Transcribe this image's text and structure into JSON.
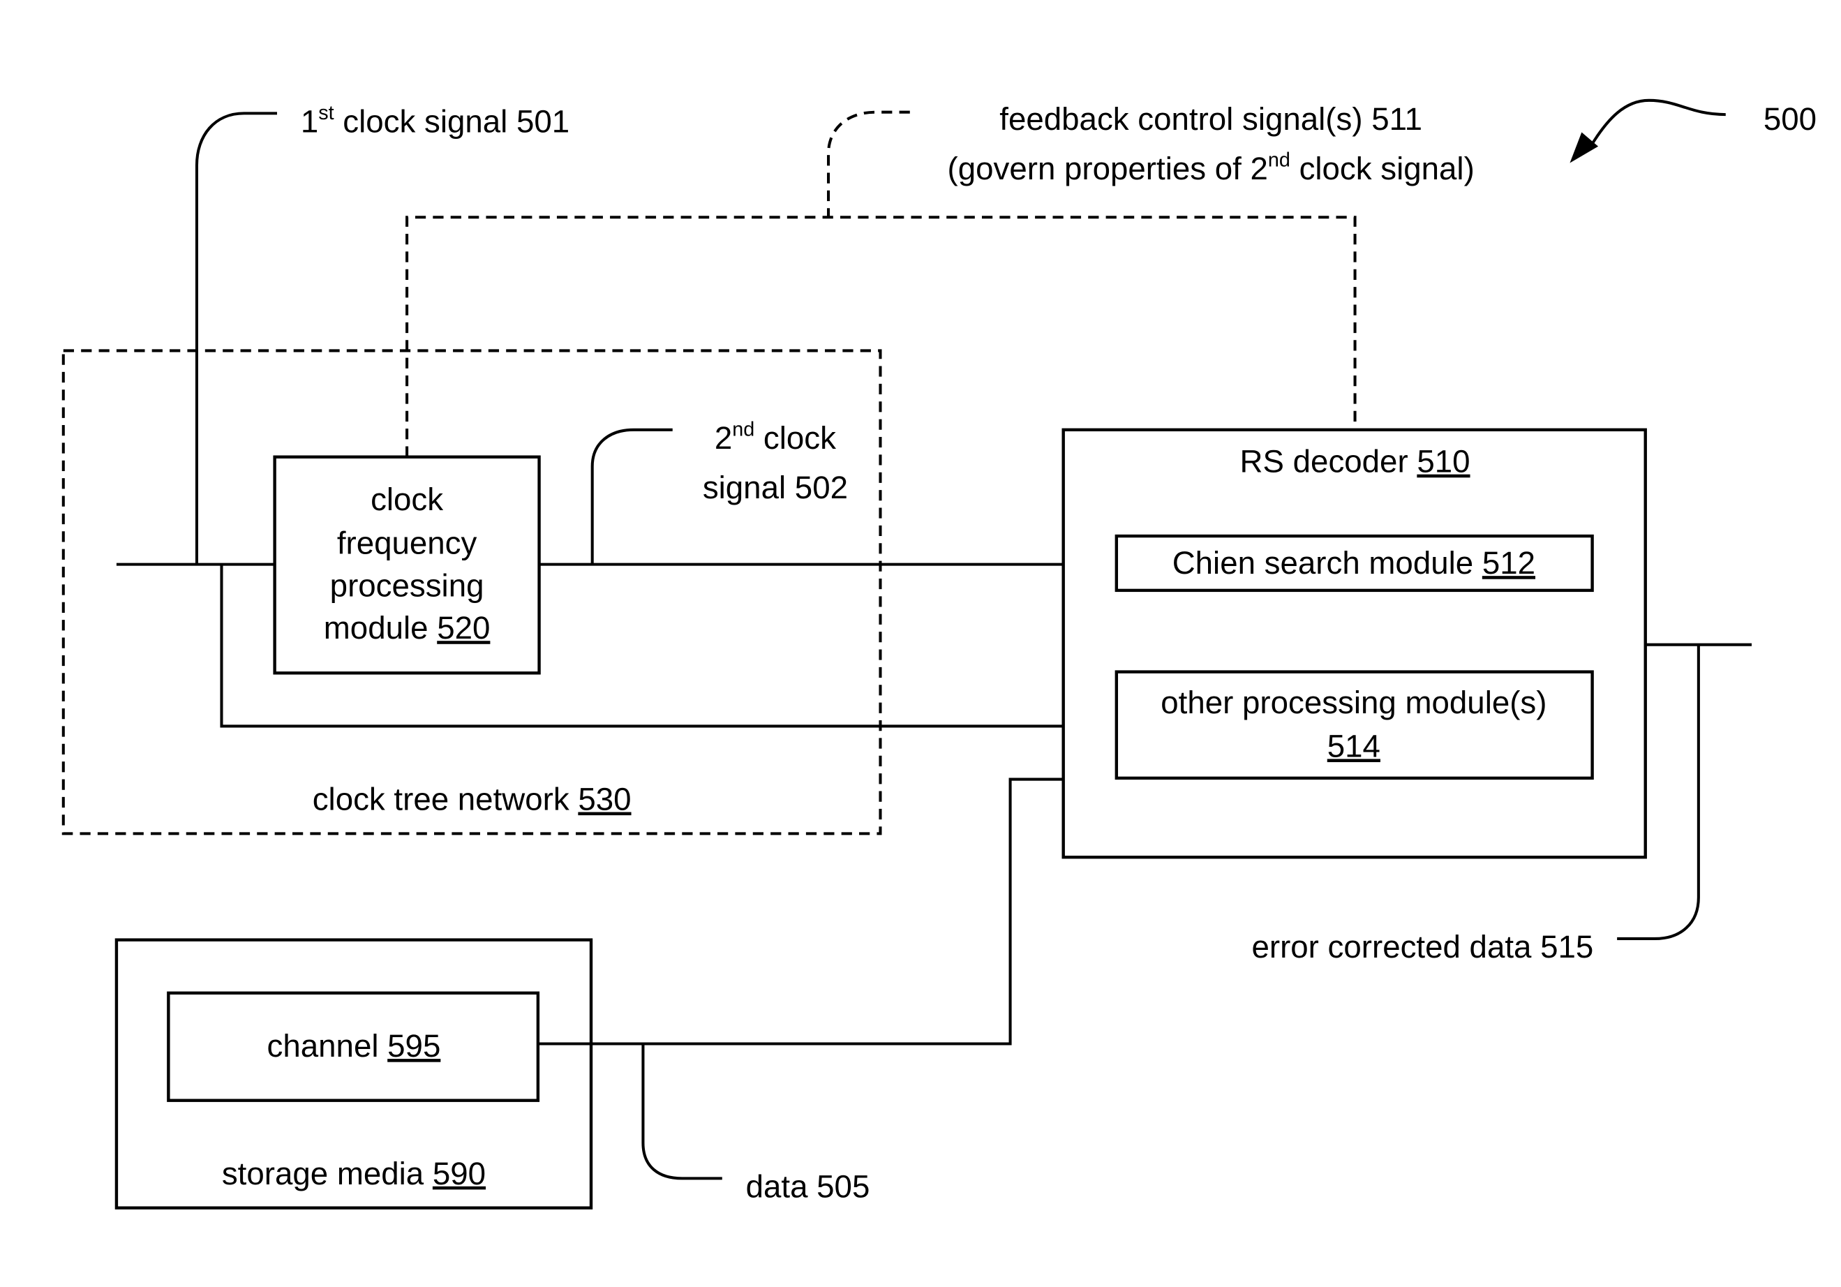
{
  "figure_ref": "500",
  "labels": {
    "clock1": {
      "pre": "1",
      "sup": "st",
      "post": " clock signal 501"
    },
    "feedback_line1": "feedback control signal(s) 511",
    "feedback_line2": {
      "pre": "(govern properties of 2",
      "sup": "nd",
      "post": " clock signal)"
    },
    "clock2_line1": {
      "pre": "2",
      "sup": "nd",
      "post": " clock"
    },
    "clock2_line2": "signal 502",
    "error_corrected": "error corrected data 515",
    "data": "data 505"
  },
  "blocks": {
    "cfpm": {
      "lines": [
        "clock",
        "frequency",
        "processing"
      ],
      "last_pre": "module ",
      "ref": "520"
    },
    "clock_tree": {
      "label": "clock tree network ",
      "ref": "530"
    },
    "rs_decoder": {
      "label": "RS decoder ",
      "ref": "510"
    },
    "chien": {
      "label": "Chien search module ",
      "ref": "512"
    },
    "other": {
      "label": "other processing module(s)",
      "ref": "514"
    },
    "storage": {
      "label": "storage media ",
      "ref": "590"
    },
    "channel": {
      "label": "channel ",
      "ref": "595"
    }
  }
}
